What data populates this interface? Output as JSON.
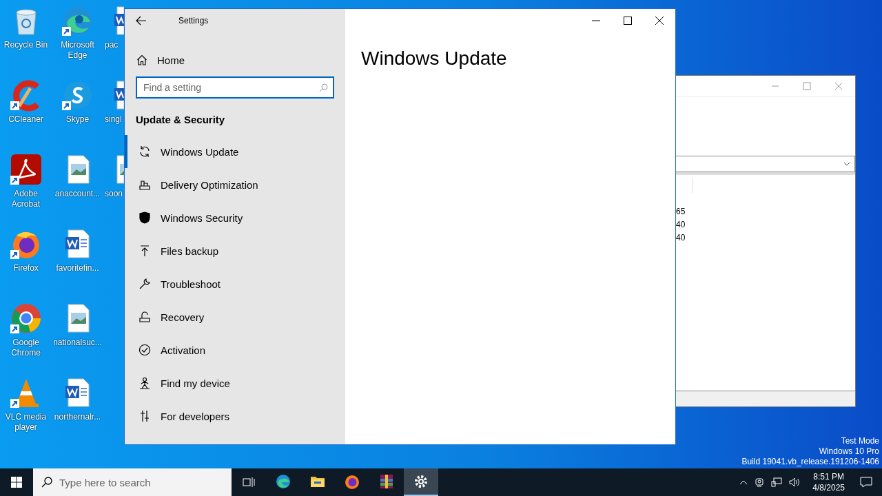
{
  "desktop": {
    "icons": [
      {
        "label": "Recycle Bin",
        "kind": "recycle",
        "shortcut": false
      },
      {
        "label": "CCleaner",
        "kind": "ccleaner",
        "shortcut": true
      },
      {
        "label": "Adobe Acrobat",
        "kind": "acrobat",
        "shortcut": true
      },
      {
        "label": "Firefox",
        "kind": "firefox",
        "shortcut": true
      },
      {
        "label": "Google Chrome",
        "kind": "chrome",
        "shortcut": true
      },
      {
        "label": "VLC media player",
        "kind": "vlc",
        "shortcut": true
      },
      {
        "label": "Microsoft Edge",
        "kind": "edge",
        "shortcut": true
      },
      {
        "label": "Skype",
        "kind": "skype",
        "shortcut": true
      },
      {
        "label": "anaccount...",
        "kind": "image",
        "shortcut": false
      },
      {
        "label": "favoritefin...",
        "kind": "word",
        "shortcut": false
      },
      {
        "label": "nationalsuc...",
        "kind": "image",
        "shortcut": false
      },
      {
        "label": "northernalr...",
        "kind": "word",
        "shortcut": false
      }
    ],
    "cut_icons": [
      {
        "label": "pac",
        "kind": "word"
      },
      {
        "label": "singl",
        "kind": "word"
      },
      {
        "label": "soon",
        "kind": "image"
      }
    ],
    "system_text": [
      "Test Mode",
      "Windows 10 Pro",
      "Build 19041.vb_release.191206-1406"
    ]
  },
  "background_window": {
    "values": [
      "65",
      "40",
      "40"
    ]
  },
  "settings": {
    "title": "Settings",
    "home": "Home",
    "search": {
      "placeholder": "Find a setting"
    },
    "section": "Update & Security",
    "nav": [
      {
        "label": "Windows Update",
        "kind": "sync",
        "selected": true
      },
      {
        "label": "Delivery Optimization",
        "kind": "delivery",
        "selected": false
      },
      {
        "label": "Windows Security",
        "kind": "shield",
        "selected": false
      },
      {
        "label": "Files backup",
        "kind": "backup",
        "selected": false
      },
      {
        "label": "Troubleshoot",
        "kind": "wrench",
        "selected": false
      },
      {
        "label": "Recovery",
        "kind": "recovery",
        "selected": false
      },
      {
        "label": "Activation",
        "kind": "check",
        "selected": false
      },
      {
        "label": "Find my device",
        "kind": "person",
        "selected": false
      },
      {
        "label": "For developers",
        "kind": "dev",
        "selected": false
      }
    ],
    "page_title": "Windows Update"
  },
  "taskbar": {
    "search": {
      "placeholder": "Type here to search"
    },
    "apps": [
      {
        "kind": "edge",
        "selected": false
      },
      {
        "kind": "folder",
        "selected": false
      },
      {
        "kind": "firefox",
        "selected": false
      },
      {
        "kind": "winrar",
        "selected": false
      },
      {
        "kind": "settings",
        "selected": true
      }
    ],
    "time": "8:51 PM",
    "date": "4/8/2025"
  }
}
